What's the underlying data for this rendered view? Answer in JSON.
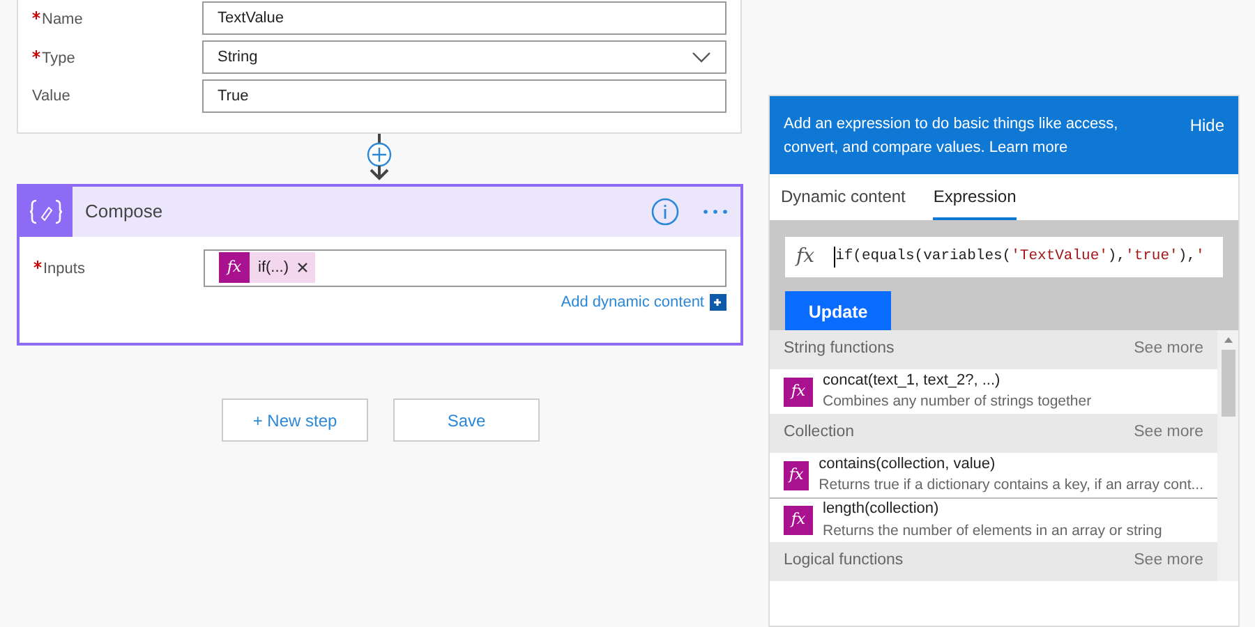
{
  "variable_card": {
    "fields": [
      {
        "label": "Name",
        "required": true,
        "kind": "text",
        "value": "TextValue"
      },
      {
        "label": "Type",
        "required": true,
        "kind": "select",
        "value": "String"
      },
      {
        "label": "Value",
        "required": false,
        "kind": "text",
        "value": "True"
      }
    ]
  },
  "compose_card": {
    "title": "Compose",
    "selected": true,
    "input": {
      "label": "Inputs",
      "required": true,
      "token_icon": "fx",
      "token": "if(...)"
    },
    "add_dynamic_content": "Add dynamic content"
  },
  "buttons": [
    "+ New step",
    "Save"
  ],
  "expression_panel": {
    "info": "Add an expression to do basic things like access, convert, and compare values.",
    "learn_more": "Learn more",
    "hide": "Hide",
    "tabs": [
      {
        "label": "Dynamic content",
        "selected": false
      },
      {
        "label": "Expression",
        "selected": true
      }
    ],
    "expression_icon": "fx",
    "expression": "if(equals(variables('TextValue'),'true'),'",
    "update": "Update",
    "groups": [
      {
        "title": "String functions",
        "see_more": "See more",
        "functions": [
          {
            "icon": "fx",
            "name": "concat(text_1, text_2?, ...)",
            "description": "Combines any number of strings together"
          }
        ]
      },
      {
        "title": "Collection",
        "see_more": "See more",
        "functions": [
          {
            "icon": "fx",
            "name": "contains(collection, value)",
            "description": "Returns true if a dictionary contains a key, if an array cont..."
          },
          {
            "icon": "fx",
            "name": "length(collection)",
            "description": "Returns the number of elements in an array or string"
          }
        ]
      },
      {
        "title": "Logical functions",
        "see_more": "See more"
      }
    ]
  }
}
